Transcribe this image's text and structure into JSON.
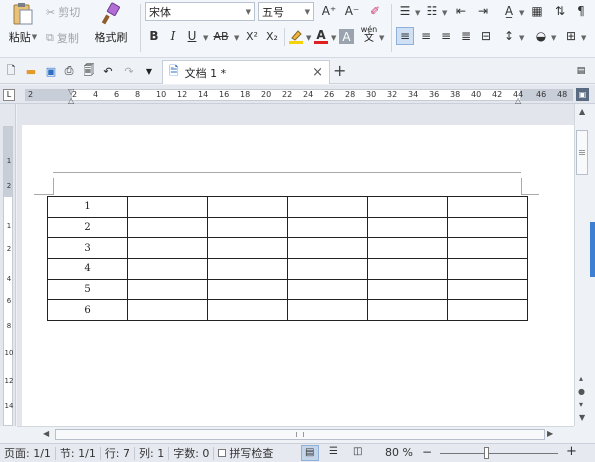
{
  "ribbon": {
    "paste_label": "粘贴",
    "cut_label": "剪切",
    "copy_label": "复制",
    "format_painter_label": "格式刷",
    "font_name": "宋体",
    "font_size": "五号",
    "bold": "B",
    "italic": "I",
    "underline": "U",
    "strike": "AB",
    "superscript": "X²",
    "subscript": "X₂",
    "font_color": "A",
    "char_shade": "A",
    "pinyin_top": "wén",
    "pinyin_bottom": "文",
    "grow_font": "A⁺",
    "shrink_font": "A⁻"
  },
  "tabbar": {
    "doc_title": "文档 1 *",
    "close_glyph": "×",
    "new_tab_glyph": "+"
  },
  "ruler": {
    "labels": [
      "2",
      "2",
      "4",
      "6",
      "8",
      "10",
      "12",
      "14",
      "16",
      "18",
      "20",
      "22",
      "24",
      "26",
      "28",
      "30",
      "32",
      "34",
      "36",
      "38",
      "40",
      "42",
      "44",
      "46",
      "48"
    ],
    "vlabels": [
      "1",
      "2",
      "1",
      "2",
      "4",
      "6",
      "8",
      "10",
      "12",
      "14"
    ]
  },
  "table": {
    "rows": [
      [
        "1",
        "",
        "",
        "",
        "",
        ""
      ],
      [
        "2",
        "",
        "",
        "",
        "",
        ""
      ],
      [
        "3",
        "",
        "",
        "",
        "",
        ""
      ],
      [
        "4",
        "",
        "",
        "",
        "",
        ""
      ],
      [
        "5",
        "",
        "",
        "",
        "",
        ""
      ],
      [
        "6",
        "",
        "",
        "",
        "",
        ""
      ]
    ]
  },
  "status": {
    "page": "页面: 1/1",
    "section": "节: 1/1",
    "line": "行: 7",
    "column": "列: 1",
    "word_count": "字数: 0",
    "spell_check": "拼写检查",
    "zoom": "80 %"
  },
  "colors": {
    "accent": "#3c7fd3",
    "highlight": "#f5d20a",
    "font_color_bar": "#e02020"
  }
}
